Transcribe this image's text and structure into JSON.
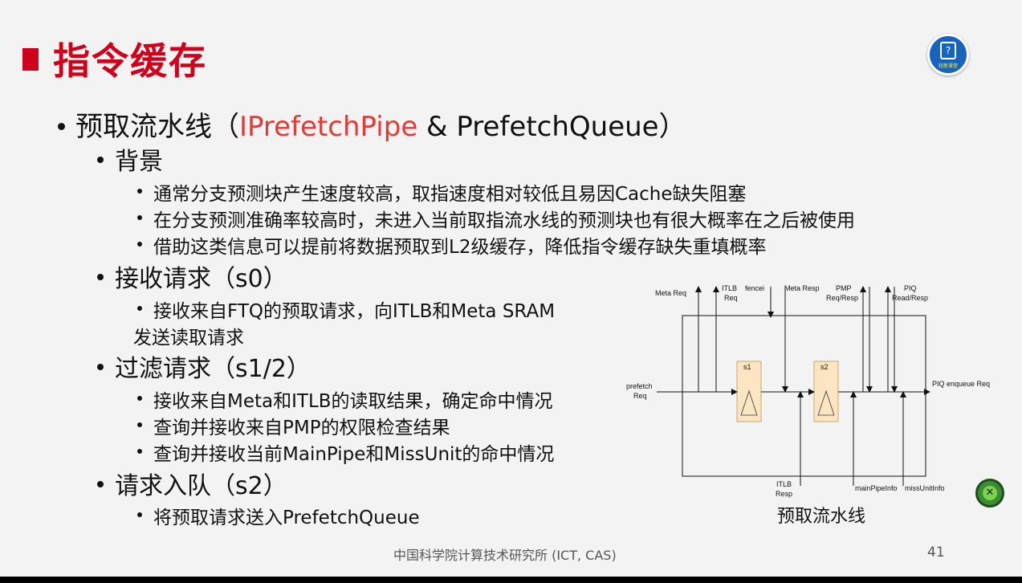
{
  "slide": {
    "title": "指令缓存",
    "badge_caption": "轻新课堂",
    "page_number": "41",
    "footer": "中国科学院计算技术研究所 (ICT, CAS)"
  },
  "bullets": {
    "main_prefix": "预取流水线（",
    "main_highlight": "IPrefetchPipe",
    "main_suffix": " & PrefetchQueue）",
    "background": {
      "heading": "背景",
      "items": [
        "通常分支预测块产生速度较高，取指速度相对较低且易因Cache缺失阻塞",
        "在分支预测准确率较高时，未进入当前取指流水线的预测块也有很大概率在之后被使用",
        "借助这类信息可以提前将数据预取到L2级缓存，降低指令缓存缺失重填概率"
      ]
    },
    "receive": {
      "heading": "接收请求（s0）",
      "line1": "接收来自FTQ的预取请求，向ITLB和Meta SRAM",
      "line2": "发送读取请求"
    },
    "filter": {
      "heading": "过滤请求（s1/2）",
      "items": [
        "接收来自Meta和ITLB的读取结果，确定命中情况",
        "查询并接收来自PMP的权限检查结果",
        "查询并接收当前MainPipe和MissUnit的命中情况"
      ]
    },
    "enqueue": {
      "heading": "请求入队（s2）",
      "items": [
        "将预取请求送入PrefetchQueue"
      ]
    }
  },
  "diagram": {
    "caption": "预取流水线",
    "labels": {
      "meta_req": "Meta Req",
      "itlb_req_1": "ITLB",
      "itlb_req_2": "Req",
      "fencei": "fencei",
      "meta_resp": "Meta Resp",
      "pmp_1": "PMP",
      "pmp_2": "Req/Resp",
      "piq_1": "PIQ",
      "piq_2": "Read/Resp",
      "prefetch_1": "prefetch",
      "prefetch_2": "Req",
      "s1": "s1",
      "s2": "s2",
      "piq_enqueue": "PIQ enqueue Req",
      "itlb_resp_1": "ITLB",
      "itlb_resp_2": "Resp",
      "main_pipe_info": "mainPipeInfo",
      "miss_unit_info": "missUnitInfo"
    },
    "colors": {
      "stage_fill": "#fbe5c3",
      "stage_stroke": "#caa86a",
      "line": "#111111"
    }
  },
  "ui": {
    "close_icon": "close-icon",
    "accent": "#d0021b",
    "highlight": "#e53935"
  }
}
